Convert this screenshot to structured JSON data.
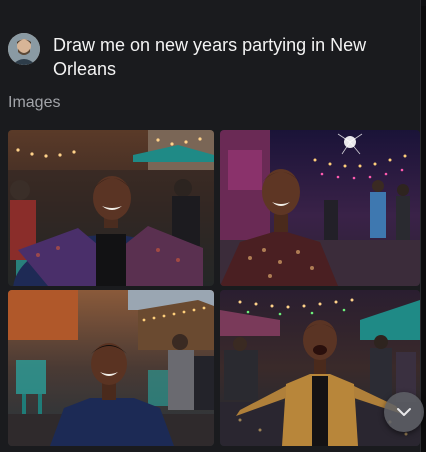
{
  "message": {
    "prompt": "Draw me on new years partying in New Orleans"
  },
  "section": {
    "label": "Images"
  },
  "images": [
    {
      "alt": "Man in patterned jacket smiling on a lit street",
      "badge": ""
    },
    {
      "alt": "Man in sequined shirt under string lights at night",
      "badge": ""
    },
    {
      "alt": "Man in dark shirt smiling outside a cafe",
      "badge": ""
    },
    {
      "alt": "Man in gold jacket cheering under fireworks",
      "badge": ""
    }
  ],
  "icons": {
    "avatar": "user-avatar",
    "scroll": "chevron-down-icon"
  },
  "colors": {
    "background": "#1a1b1e",
    "prompt_text": "#f3f3f3",
    "label_text": "#a2a4a9",
    "scroll_button": "#5f6167"
  }
}
